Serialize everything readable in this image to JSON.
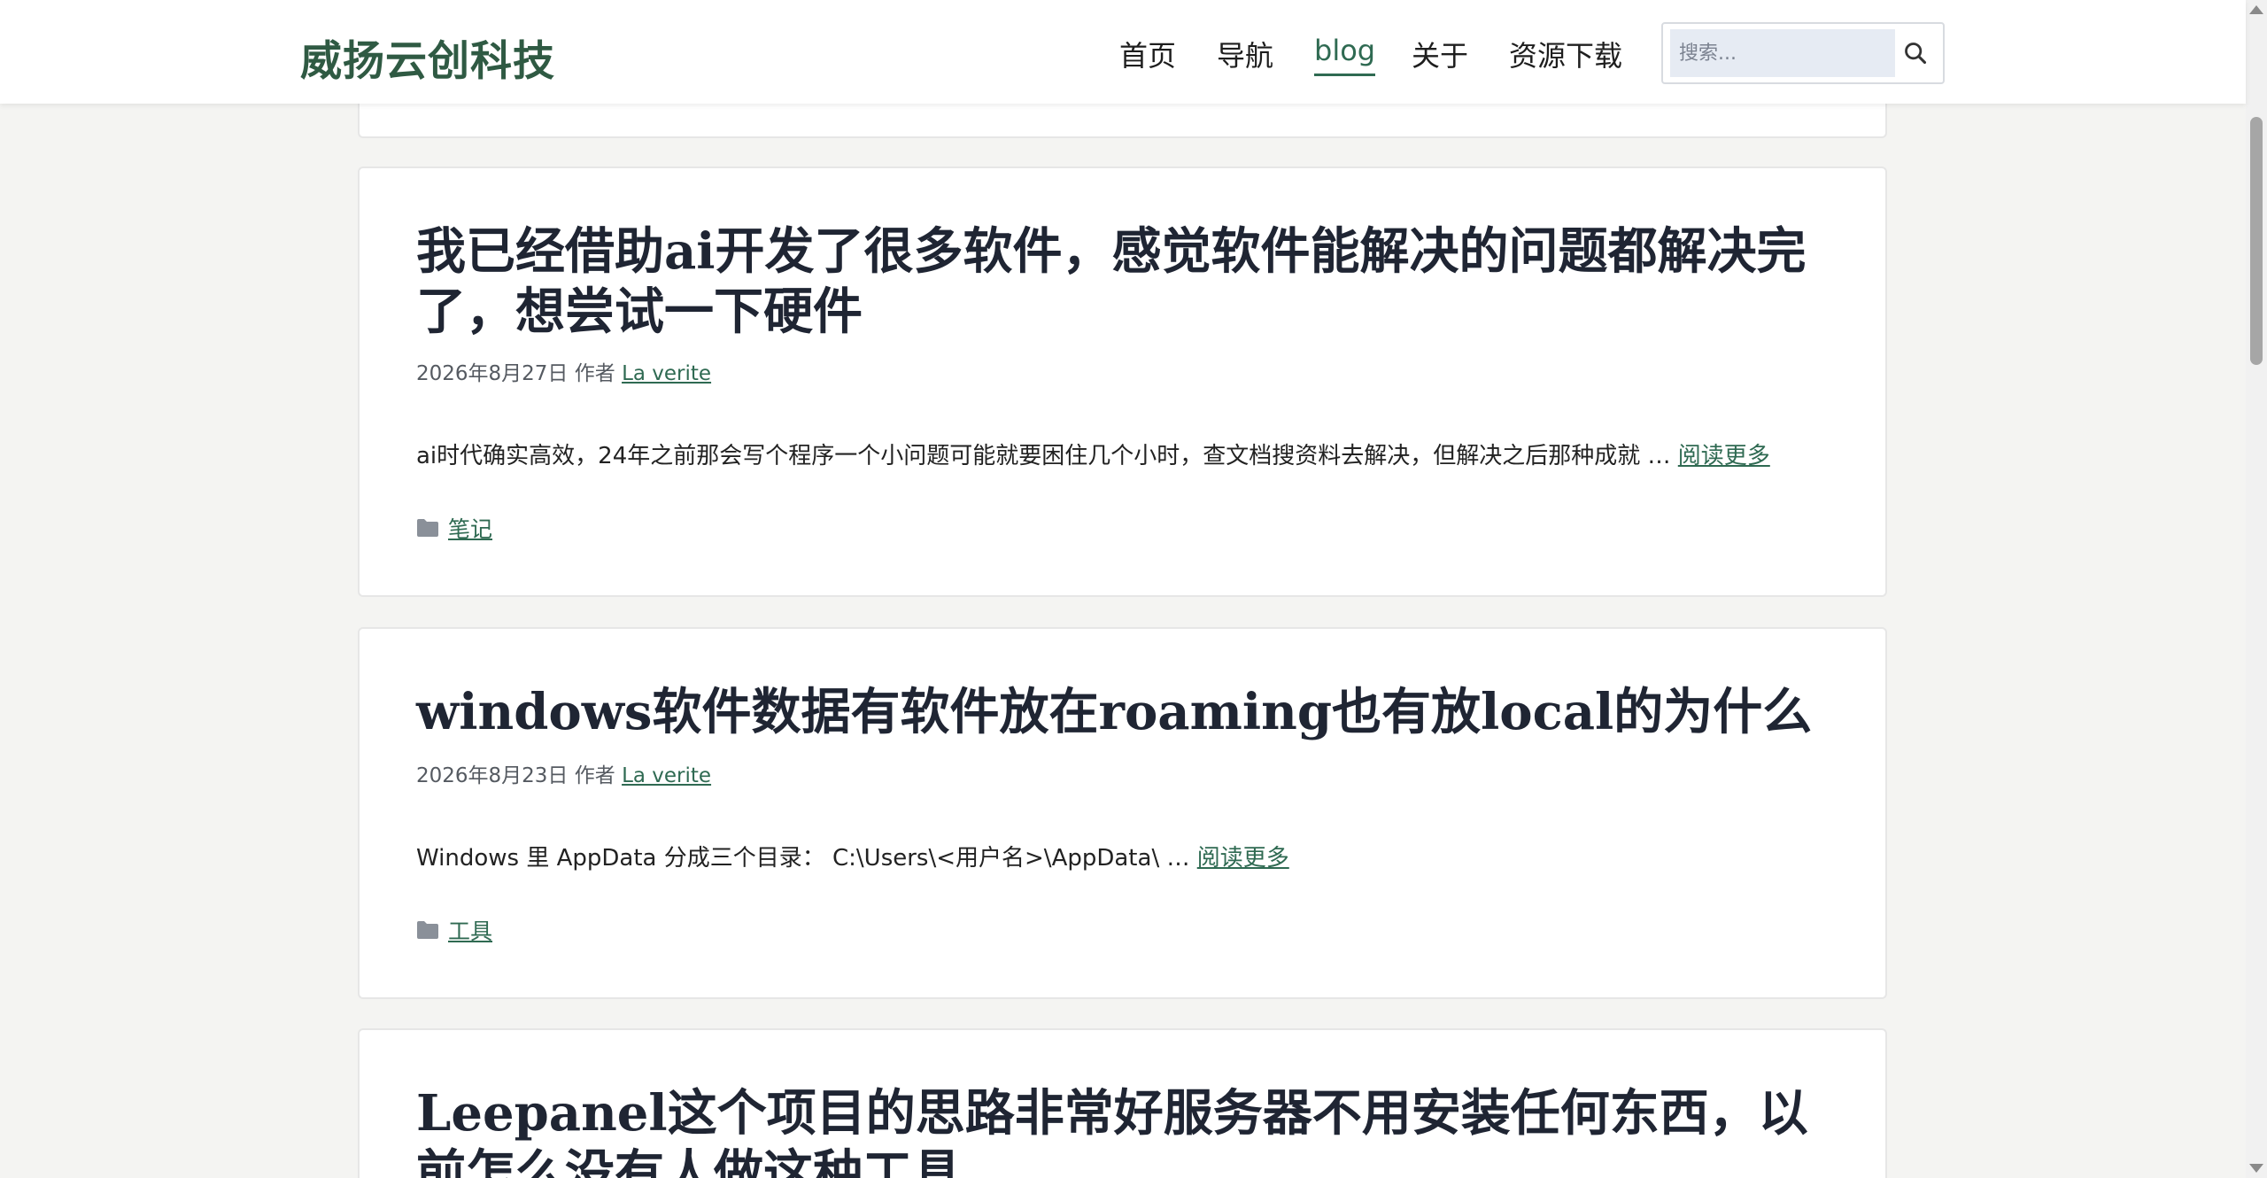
{
  "header": {
    "site_title": "威扬云创科技",
    "nav": [
      {
        "label": "首页"
      },
      {
        "label": "导航"
      },
      {
        "label": "blog"
      },
      {
        "label": "关于"
      },
      {
        "label": "资源下载"
      }
    ],
    "search_placeholder": "搜索..."
  },
  "posts": [
    {
      "title": "我已经借助ai开发了很多软件，感觉软件能解决的问题都解决完了，想尝试一下硬件",
      "date": "2026年8月27日",
      "author_prefix": "作者",
      "author": "La verite",
      "excerpt": "ai时代确实高效，24年之前那会写个程序一个小问题可能就要困住几个小时，查文档搜资料去解决，但解决之后那种成就 …",
      "read_more": "阅读更多",
      "category": "笔记"
    },
    {
      "title": "windows软件数据有软件放在roaming也有放local的为什么",
      "date": "2026年8月23日",
      "author_prefix": "作者",
      "author": "La verite",
      "excerpt": "Windows 里 AppData 分成三个目录：  C:\\Users\\<用户名>\\AppData\\ …",
      "read_more": "阅读更多",
      "category": "工具"
    },
    {
      "title": "Leepanel这个项目的思路非常好服务器不用安装任何东西，以前怎么没有人做这种工具"
    }
  ],
  "colors": {
    "brand": "#2f5a43",
    "link": "#2f6a52",
    "background": "#f4f4f2"
  },
  "icons": {
    "search": "magnifier-icon",
    "category": "folder-icon"
  }
}
